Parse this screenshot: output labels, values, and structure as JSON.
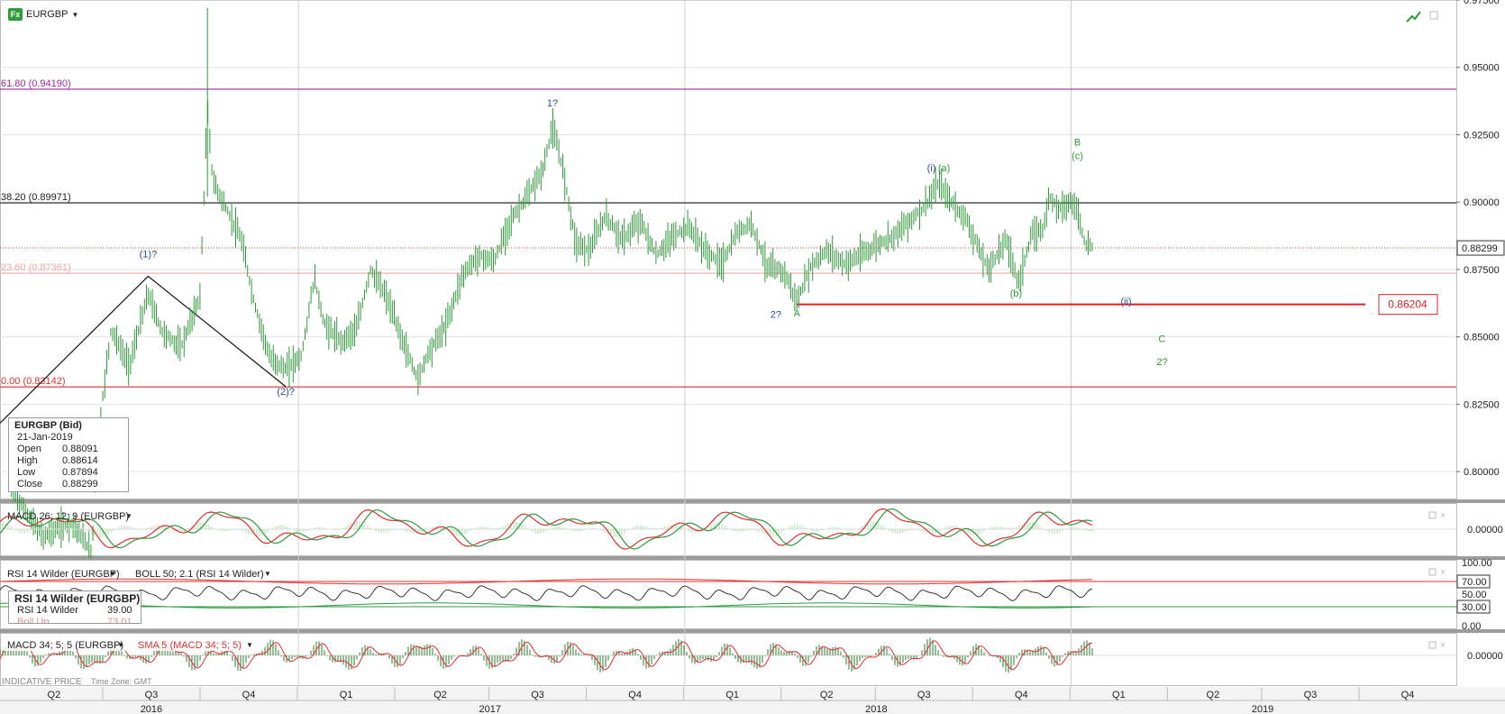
{
  "symbol": {
    "name": "EURGBP",
    "icon": "fx-icon"
  },
  "price_box": {
    "title": "EURGBP (Bid)",
    "date": "21-Jan-2019",
    "rows": [
      {
        "k": "Open",
        "v": "0.88091"
      },
      {
        "k": "High",
        "v": "0.88614"
      },
      {
        "k": "Low",
        "v": "0.87894"
      },
      {
        "k": "Close",
        "v": "0.88299"
      }
    ]
  },
  "rsi_box": {
    "title": "RSI 14 Wilder (EURGBP)",
    "rows": [
      {
        "k": "RSI 14 Wilder",
        "v": "39.00"
      },
      {
        "k": "Boll Up",
        "v": "73.01"
      }
    ]
  },
  "panels": {
    "macd1_label": "MACD 26; 12; 9 (EURGBP)",
    "rsi_label": "RSI 14 Wilder (EURGBP)",
    "boll_label": "BOLL 50; 2.1 (RSI 14 Wilder)",
    "macd2_label": "MACD 34; 5; 5 (EURGBP)",
    "sma_label": "SMA 5 (MACD 34; 5; 5)",
    "footer_left": "INDICATIVE PRICE",
    "footer_tz": "Time Zone: GMT"
  },
  "colors": {
    "price": "#2f9a3a",
    "fib_618": "#9b2b9b",
    "fib_382": "#222222",
    "fib_236": "#f2a6a6",
    "fib_000": "#e03030",
    "support": "#e02020",
    "wave_blue": "#2a4f9a",
    "wave_green": "#2f9a3a",
    "macd_red": "#e03030",
    "macd_green": "#2f9a3a",
    "hist": "#a8d9a8"
  },
  "chart_data": [
    {
      "type": "line",
      "series": [
        {
          "values": [
            {
              "t": "2016-04-05",
              "v": 0.793
            },
            {
              "t": "2016-05-04",
              "v": 0.776
            },
            {
              "t": "2016-06-01",
              "v": 0.781
            },
            {
              "t": "2016-06-20",
              "v": 0.77
            },
            {
              "t": "2016-06-24",
              "v": 0.808
            },
            {
              "t": "2016-07-08",
              "v": 0.853
            },
            {
              "t": "2016-07-25",
              "v": 0.839
            },
            {
              "t": "2016-08-12",
              "v": 0.866
            },
            {
              "t": "2016-08-25",
              "v": 0.852
            },
            {
              "t": "2016-09-12",
              "v": 0.846
            },
            {
              "t": "2016-09-30",
              "v": 0.865
            },
            {
              "t": "2016-10-07",
              "v": 0.935
            },
            {
              "t": "2016-10-12",
              "v": 0.908
            },
            {
              "t": "2016-10-28",
              "v": 0.895
            },
            {
              "t": "2016-11-08",
              "v": 0.886
            },
            {
              "t": "2016-11-20",
              "v": 0.863
            },
            {
              "t": "2016-12-05",
              "v": 0.842
            },
            {
              "t": "2016-12-20",
              "v": 0.838
            },
            {
              "t": "2017-01-04",
              "v": 0.843
            },
            {
              "t": "2017-01-16",
              "v": 0.872
            },
            {
              "t": "2017-01-25",
              "v": 0.855
            },
            {
              "t": "2017-02-10",
              "v": 0.848
            },
            {
              "t": "2017-02-25",
              "v": 0.853
            },
            {
              "t": "2017-03-10",
              "v": 0.875
            },
            {
              "t": "2017-03-25",
              "v": 0.865
            },
            {
              "t": "2017-04-10",
              "v": 0.848
            },
            {
              "t": "2017-04-24",
              "v": 0.834
            },
            {
              "t": "2017-05-02",
              "v": 0.843
            },
            {
              "t": "2017-05-20",
              "v": 0.854
            },
            {
              "t": "2017-06-05",
              "v": 0.873
            },
            {
              "t": "2017-06-20",
              "v": 0.88
            },
            {
              "t": "2017-07-05",
              "v": 0.878
            },
            {
              "t": "2017-07-20",
              "v": 0.893
            },
            {
              "t": "2017-08-05",
              "v": 0.902
            },
            {
              "t": "2017-08-20",
              "v": 0.912
            },
            {
              "t": "2017-08-29",
              "v": 0.928
            },
            {
              "t": "2017-09-08",
              "v": 0.912
            },
            {
              "t": "2017-09-20",
              "v": 0.885
            },
            {
              "t": "2017-10-03",
              "v": 0.882
            },
            {
              "t": "2017-10-18",
              "v": 0.895
            },
            {
              "t": "2017-11-03",
              "v": 0.886
            },
            {
              "t": "2017-11-20",
              "v": 0.893
            },
            {
              "t": "2017-12-05",
              "v": 0.88
            },
            {
              "t": "2017-12-20",
              "v": 0.887
            },
            {
              "t": "2018-01-05",
              "v": 0.891
            },
            {
              "t": "2018-01-20",
              "v": 0.882
            },
            {
              "t": "2018-02-05",
              "v": 0.877
            },
            {
              "t": "2018-02-20",
              "v": 0.889
            },
            {
              "t": "2018-03-05",
              "v": 0.892
            },
            {
              "t": "2018-03-20",
              "v": 0.876
            },
            {
              "t": "2018-04-05",
              "v": 0.874
            },
            {
              "t": "2018-04-17",
              "v": 0.863
            },
            {
              "t": "2018-04-30",
              "v": 0.876
            },
            {
              "t": "2018-05-15",
              "v": 0.882
            },
            {
              "t": "2018-06-01",
              "v": 0.877
            },
            {
              "t": "2018-06-15",
              "v": 0.88
            },
            {
              "t": "2018-07-01",
              "v": 0.884
            },
            {
              "t": "2018-07-15",
              "v": 0.887
            },
            {
              "t": "2018-08-01",
              "v": 0.893
            },
            {
              "t": "2018-08-15",
              "v": 0.898
            },
            {
              "t": "2018-08-29",
              "v": 0.907
            },
            {
              "t": "2018-09-10",
              "v": 0.9
            },
            {
              "t": "2018-09-25",
              "v": 0.893
            },
            {
              "t": "2018-10-05",
              "v": 0.883
            },
            {
              "t": "2018-10-15",
              "v": 0.875
            },
            {
              "t": "2018-10-25",
              "v": 0.882
            },
            {
              "t": "2018-11-01",
              "v": 0.886
            },
            {
              "t": "2018-11-12",
              "v": 0.87
            },
            {
              "t": "2018-11-25",
              "v": 0.888
            },
            {
              "t": "2018-12-05",
              "v": 0.89
            },
            {
              "t": "2018-12-12",
              "v": 0.902
            },
            {
              "t": "2018-12-20",
              "v": 0.898
            },
            {
              "t": "2019-01-01",
              "v": 0.9
            },
            {
              "t": "2019-01-07",
              "v": 0.897
            },
            {
              "t": "2019-01-14",
              "v": 0.885
            },
            {
              "t": "2019-01-21",
              "v": 0.883
            }
          ]
        }
      ],
      "y_ticks": [
        "0.97500",
        "0.95000",
        "0.92500",
        "0.90000",
        "0.87500",
        "0.85000",
        "0.82500",
        "0.80000"
      ],
      "ylim": [
        0.79,
        0.975
      ],
      "xlim": [
        "2016-03-25",
        "2019-12-31"
      ],
      "current_price_label": "0.88299",
      "current_price": 0.88299,
      "support_label": "0.86204",
      "support_value": 0.86204,
      "fib_levels": [
        {
          "label": "61.80 (0.94190)",
          "value": 0.9419,
          "color_key": "fib_618"
        },
        {
          "label": "38.20 (0.89971)",
          "value": 0.89971,
          "color_key": "fib_382"
        },
        {
          "label": "23.60 (0.87361)",
          "value": 0.87361,
          "color_key": "fib_236"
        },
        {
          "label": "0.00 (0.83142)",
          "value": 0.83142,
          "color_key": "fib_000"
        }
      ],
      "wave_labels": [
        {
          "text": "(1)?",
          "t": "2016-08-12",
          "v": 0.8795,
          "color_key": "wave_blue"
        },
        {
          "text": "(2)?",
          "t": "2016-12-20",
          "v": 0.8285,
          "color_key": "wave_blue"
        },
        {
          "text": "1?",
          "t": "2017-08-29",
          "v": 0.9355,
          "color_key": "wave_blue"
        },
        {
          "text": "2?",
          "t": "2018-03-28",
          "v": 0.857,
          "color_key": "wave_blue"
        },
        {
          "text": "A",
          "t": "2018-04-17",
          "v": 0.8575,
          "color_key": "wave_green"
        },
        {
          "text": "(i)",
          "t": "2018-08-22",
          "v": 0.9115,
          "color_key": "wave_blue"
        },
        {
          "text": "(a)",
          "t": "2018-09-03",
          "v": 0.9115,
          "color_key": "wave_green"
        },
        {
          "text": "(b)",
          "t": "2018-11-10",
          "v": 0.865,
          "color_key": "wave_green"
        },
        {
          "text": "B",
          "t": "2019-01-07",
          "v": 0.921,
          "color_key": "wave_green"
        },
        {
          "text": "(c)",
          "t": "2019-01-07",
          "v": 0.916,
          "color_key": "wave_green"
        },
        {
          "text": "(ii)",
          "t": "2019-02-22",
          "v": 0.862,
          "color_key": "wave_blue"
        },
        {
          "text": "C",
          "t": "2019-03-28",
          "v": 0.848,
          "color_key": "wave_green"
        },
        {
          "text": "2?",
          "t": "2019-03-28",
          "v": 0.8395,
          "color_key": "wave_green"
        }
      ],
      "wave_lines": [
        [
          {
            "t": "2016-03-25",
            "v": 0.818
          },
          {
            "t": "2016-08-12",
            "v": 0.8725
          },
          {
            "t": "2016-12-20",
            "v": 0.8315
          }
        ]
      ]
    },
    {
      "type": "line",
      "y_ticks": [
        "0.00000"
      ]
    },
    {
      "type": "line",
      "y_ticks": [
        "100.00",
        "70.00",
        "50.00",
        "30.00",
        "0.00"
      ],
      "ylim": [
        0,
        100
      ],
      "levels": [
        70,
        30
      ]
    },
    {
      "type": "bar",
      "y_ticks": [
        "0.00000"
      ]
    }
  ],
  "x_axis": {
    "quarters": [
      {
        "label": "Q2",
        "t": "2016-05-15"
      },
      {
        "label": "Q3",
        "t": "2016-08-15"
      },
      {
        "label": "Q4",
        "t": "2016-11-15"
      },
      {
        "label": "Q1",
        "t": "2017-02-15"
      },
      {
        "label": "Q2",
        "t": "2017-05-15"
      },
      {
        "label": "Q3",
        "t": "2017-08-15"
      },
      {
        "label": "Q4",
        "t": "2017-11-15"
      },
      {
        "label": "Q1",
        "t": "2018-02-15"
      },
      {
        "label": "Q2",
        "t": "2018-05-15"
      },
      {
        "label": "Q3",
        "t": "2018-08-15"
      },
      {
        "label": "Q4",
        "t": "2018-11-15"
      },
      {
        "label": "Q1",
        "t": "2019-02-15"
      },
      {
        "label": "Q2",
        "t": "2019-05-15"
      },
      {
        "label": "Q3",
        "t": "2019-08-15"
      },
      {
        "label": "Q4",
        "t": "2019-11-15"
      }
    ],
    "years": [
      {
        "label": "2016",
        "t": "2016-08-15"
      },
      {
        "label": "2017",
        "t": "2017-07-01"
      },
      {
        "label": "2018",
        "t": "2018-07-01"
      },
      {
        "label": "2019",
        "t": "2019-07-01"
      }
    ],
    "year_starts": [
      "2017-01-01",
      "2018-01-01",
      "2019-01-01"
    ]
  }
}
